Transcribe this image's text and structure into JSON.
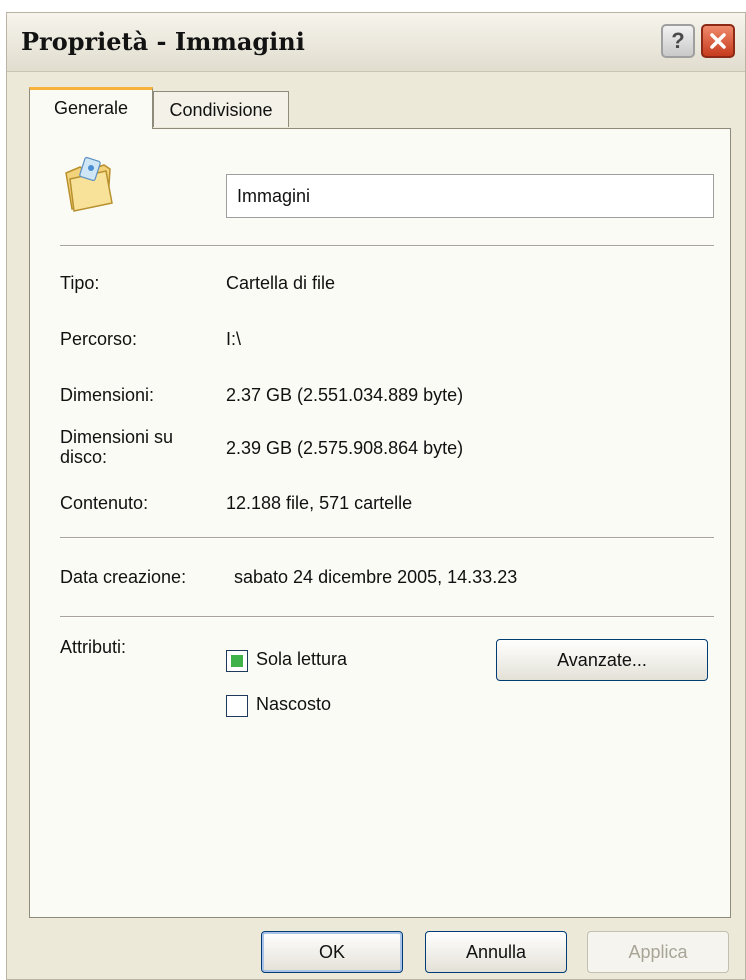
{
  "window": {
    "title": "Proprietà - Immagini",
    "help_label": "?",
    "close_icon": "close-icon"
  },
  "tabs": [
    {
      "label": "Generale",
      "active": true
    },
    {
      "label": "Condivisione",
      "active": false
    }
  ],
  "general": {
    "folder_icon": "folder-icon",
    "name_value": "Immagini",
    "fields": {
      "type": {
        "label": "Tipo:",
        "value": "Cartella di file"
      },
      "location": {
        "label": "Percorso:",
        "value": "I:\\"
      },
      "size": {
        "label": "Dimensioni:",
        "value": "2.37 GB (2.551.034.889 byte)"
      },
      "size_on_disk": {
        "label": "Dimensioni su disco:",
        "value": "2.39 GB (2.575.908.864 byte)"
      },
      "contents": {
        "label": "Contenuto:",
        "value": "12.188 file, 571 cartelle"
      },
      "created": {
        "label": "Data creazione:",
        "value": "sabato 24 dicembre 2005, 14.33.23"
      }
    },
    "attributes": {
      "label": "Attributi:",
      "read_only": {
        "label": "Sola lettura",
        "checked": true
      },
      "hidden": {
        "label": "Nascosto",
        "checked": false
      },
      "advanced_label": "Avanzate..."
    }
  },
  "buttons": {
    "ok": "OK",
    "cancel": "Annulla",
    "apply": "Applica"
  },
  "colors": {
    "dialog_bg": "#ece9d8",
    "panel_bg": "#fbfbf6",
    "active_tab_accent": "#f6b23a",
    "close_button": "#c63a1c",
    "checkbox_fill": "#3fb34a"
  }
}
